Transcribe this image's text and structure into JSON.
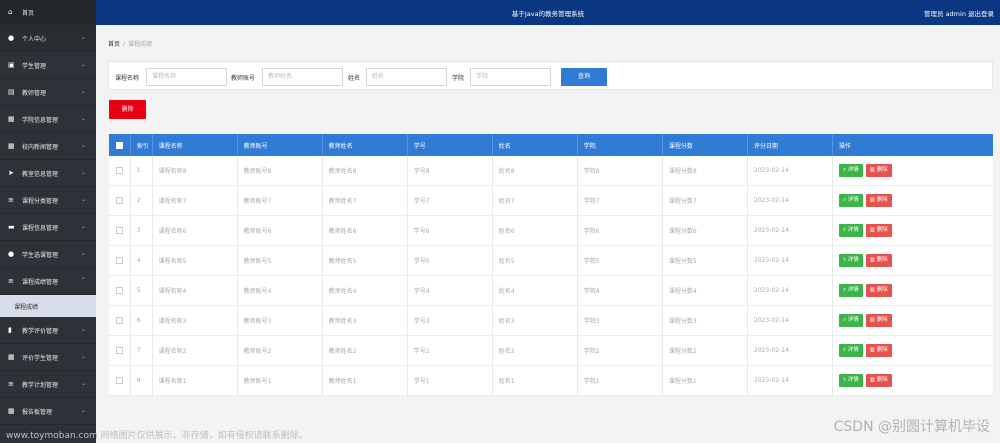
{
  "app": {
    "title": "基于Java的教务管理系统",
    "user": "管理员 admin  退出登录"
  },
  "sidebar": {
    "home": {
      "icon": "home-icon",
      "label": "首页"
    },
    "items": [
      {
        "icon": "user-icon",
        "label": "个人中心"
      },
      {
        "icon": "id-card-icon",
        "label": "学生管理"
      },
      {
        "icon": "teacher-icon",
        "label": "教师管理"
      },
      {
        "icon": "grid-icon",
        "label": "学院信息管理"
      },
      {
        "icon": "grid-icon",
        "label": "校内新闻管理"
      },
      {
        "icon": "send-icon",
        "label": "教室信息管理"
      },
      {
        "icon": "list-icon",
        "label": "课程分类管理"
      },
      {
        "icon": "book-icon",
        "label": "课程信息管理"
      },
      {
        "icon": "user-icon",
        "label": "学生选课管理"
      },
      {
        "icon": "list-icon",
        "label": "课程成绩管理"
      }
    ],
    "sub_item": "课程成绩",
    "items_after": [
      {
        "icon": "bar-chart-icon",
        "label": "教学评价管理"
      },
      {
        "icon": "grid-icon",
        "label": "评价学生管理"
      },
      {
        "icon": "list-icon",
        "label": "教学计划管理"
      },
      {
        "icon": "grid-icon",
        "label": "报告板管理"
      }
    ]
  },
  "breadcrumb": {
    "home": "首页",
    "sep": "/",
    "current": "课程成绩"
  },
  "search": {
    "fields": [
      {
        "label": "课程名称",
        "placeholder": "课程名称"
      },
      {
        "label": "教师账号",
        "placeholder": "教师姓名"
      },
      {
        "label": "姓名",
        "placeholder": "姓名"
      },
      {
        "label": "学院",
        "placeholder": "学院"
      }
    ],
    "button": "查询"
  },
  "delete_button": "删除",
  "table": {
    "headers": [
      "索引",
      "课程名称",
      "教师账号",
      "教师姓名",
      "学号",
      "姓名",
      "学院",
      "课程分数",
      "评分日期",
      "操作"
    ],
    "rows": [
      [
        "1",
        "课程名称8",
        "教师账号8",
        "教师姓名8",
        "学号8",
        "姓名8",
        "学院8",
        "课程分数8",
        "2023-02-14"
      ],
      [
        "2",
        "课程名称7",
        "教师账号7",
        "教师姓名7",
        "学号7",
        "姓名7",
        "学院7",
        "课程分数7",
        "2023-02-14"
      ],
      [
        "3",
        "课程名称6",
        "教师账号6",
        "教师姓名6",
        "学号6",
        "姓名6",
        "学院6",
        "课程分数6",
        "2023-02-14"
      ],
      [
        "4",
        "课程名称5",
        "教师账号5",
        "教师姓名5",
        "学号5",
        "姓名5",
        "学院5",
        "课程分数5",
        "2023-02-14"
      ],
      [
        "5",
        "课程名称4",
        "教师账号4",
        "教师姓名4",
        "学号4",
        "姓名4",
        "学院4",
        "课程分数4",
        "2023-02-14"
      ],
      [
        "6",
        "课程名称3",
        "教师账号3",
        "教师姓名3",
        "学号3",
        "姓名3",
        "学院3",
        "课程分数3",
        "2023-02-14"
      ],
      [
        "7",
        "课程名称2",
        "教师账号2",
        "教师姓名2",
        "学号2",
        "姓名2",
        "学院2",
        "课程分数2",
        "2023-02-14"
      ],
      [
        "8",
        "课程名称1",
        "教师账号1",
        "教师姓名1",
        "学号1",
        "姓名1",
        "学院1",
        "课程分数1",
        "2023-02-14"
      ]
    ],
    "action_detail": "详情",
    "action_delete": "删除"
  },
  "watermarks": {
    "left": "www.toymoban.com 网络图片仅供展示，非存储，如有侵权请联系删除。",
    "right": "CSDN @别圆计算机毕设"
  },
  "colors": {
    "topbar": "#0b3681",
    "sidebar": "#2e3238",
    "primary": "#2f7bd6",
    "danger": "#e60012",
    "success": "#39b54a"
  }
}
